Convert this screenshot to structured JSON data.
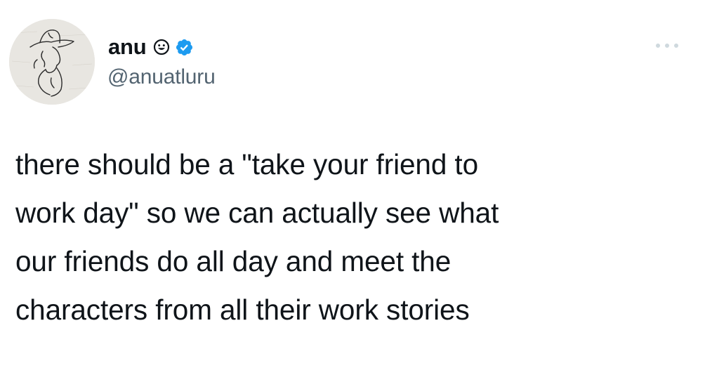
{
  "tweet": {
    "author": {
      "display_name": "anu",
      "handle": "@anuatluru",
      "name_emoji_icon": "smiling-face-icon",
      "verified_icon": "verified-badge-icon",
      "avatar_icon": "cowboy-sketch-avatar"
    },
    "text": "there should be a \"take your friend to\nwork day\" so we can actually see what\nour friends do all day and meet the\ncharacters from all their work stories",
    "more_icon": "more-horizontal-icon"
  },
  "colors": {
    "text_primary": "#0f1419",
    "text_secondary": "#536471",
    "verified_blue": "#1d9bf0",
    "more_icon_gray": "#cfd9de",
    "background": "#ffffff"
  }
}
